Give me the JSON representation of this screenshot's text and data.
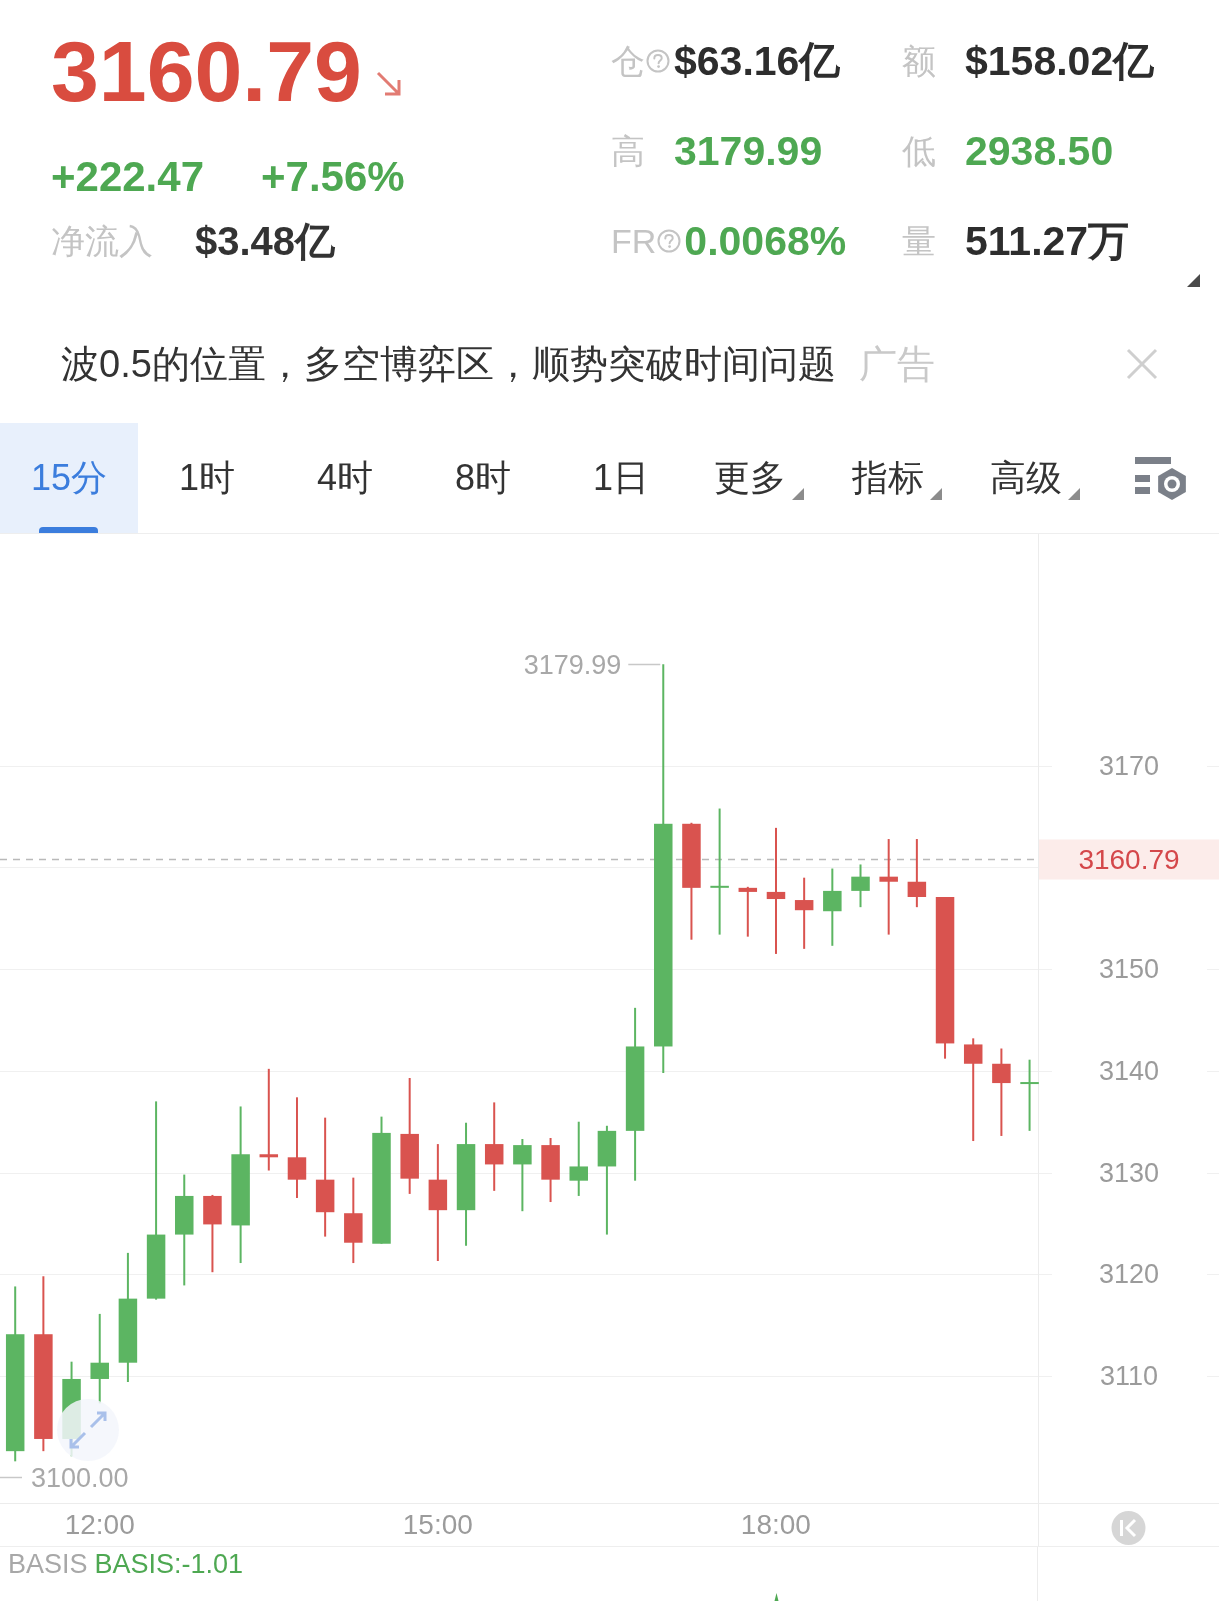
{
  "quote": {
    "price": "3160.79",
    "falling": true,
    "change": "+222.47",
    "change_percent": "+7.56%",
    "net_inflow": {
      "label": "净流入",
      "value": "$3.48亿"
    },
    "stats": [
      {
        "label": "仓",
        "help": true,
        "value": "$63.16亿",
        "color": "#2d2d2d"
      },
      {
        "label": "额",
        "help": false,
        "value": "$158.02亿",
        "color": "#2d2d2d"
      },
      {
        "label": "高",
        "help": false,
        "value": "3179.99",
        "color": "#4ea852"
      },
      {
        "label": "低",
        "help": false,
        "value": "2938.50",
        "color": "#4ea852"
      },
      {
        "label": "FR",
        "help": true,
        "value": "0.0068%",
        "color": "#4ea852"
      },
      {
        "label": "量",
        "help": false,
        "value": "511.27万",
        "color": "#2d2d2d"
      }
    ]
  },
  "ad": {
    "text": "波0.5的位置，多空博弈区，顺势突破时间问题",
    "tag": "广告"
  },
  "tabs": [
    {
      "label": "15分",
      "kind": "period",
      "selected": true
    },
    {
      "label": "1时",
      "kind": "period",
      "selected": false
    },
    {
      "label": "4时",
      "kind": "period",
      "selected": false
    },
    {
      "label": "8时",
      "kind": "period",
      "selected": false
    },
    {
      "label": "1日",
      "kind": "period",
      "selected": false
    },
    {
      "label": "更多",
      "kind": "menu",
      "selected": false
    },
    {
      "label": "指标",
      "kind": "menu",
      "selected": false
    },
    {
      "label": "高级",
      "kind": "menu",
      "selected": false
    }
  ],
  "chart": {
    "high_marker": "3179.99",
    "price_labels": [
      "3170",
      "3150",
      "3140",
      "3130",
      "3120",
      "3110"
    ],
    "last_price": "3160.79",
    "low_marker": "3100.00",
    "time_labels": [
      "12:00",
      "15:00",
      "18:00"
    ]
  },
  "indicator": {
    "name": "BASIS",
    "reading": "BASIS:-1.01"
  }
}
